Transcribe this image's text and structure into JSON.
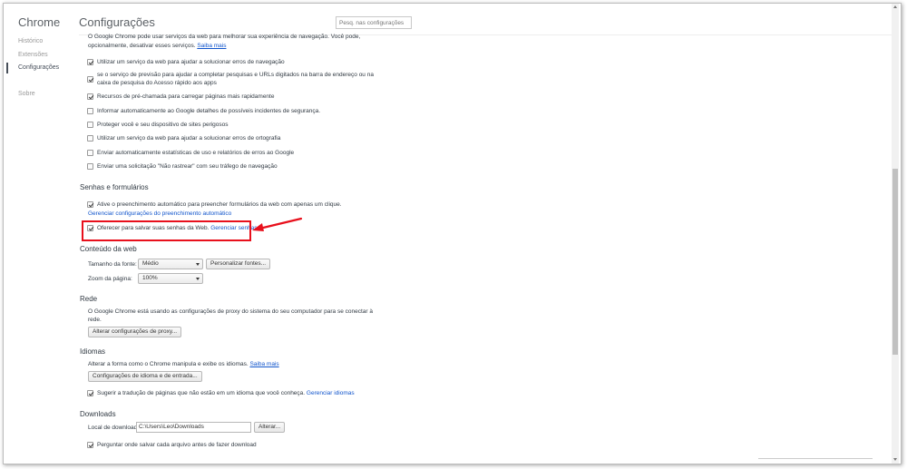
{
  "sidebar": {
    "brand": "Chrome",
    "items": [
      {
        "label": "Histórico"
      },
      {
        "label": "Extensões"
      },
      {
        "label": "Configurações",
        "active": true
      },
      {
        "label": "Sobre"
      }
    ]
  },
  "header": {
    "title": "Configurações",
    "search_placeholder": "Pesq. nas configurações"
  },
  "privacy": {
    "intro_line1": "O Google Chrome pode usar serviços da web para melhorar sua experiência de navegação. Você pode,",
    "intro_line2": "opcionalmente, desativar esses serviços. ",
    "learn_more": "Saiba mais",
    "options": [
      {
        "label": "Utilizar um serviço da web para ajudar a solucionar erros de navegação",
        "checked": true
      },
      {
        "label_line1": "se o serviço de previsão para ajudar a completar pesquisas e URLs digitados na barra de endereço ou na",
        "label_line2": "caixa de pesquisa do Acesso rápido aos apps",
        "checked": true
      },
      {
        "label": "Recursos de pré-chamada para carregar páginas mais rapidamente",
        "checked": true
      },
      {
        "label": "Informar automaticamente ao Google detalhes de possíveis incidentes de segurança.",
        "checked": false
      },
      {
        "label": "Proteger você e seu dispositivo de sites perigosos",
        "checked": false
      },
      {
        "label": "Utilizar um serviço da web para ajudar a solucionar erros de ortografia",
        "checked": false
      },
      {
        "label": "Enviar automaticamente estatísticas de uso e relatórios de erros ao Google",
        "checked": false
      },
      {
        "label": "Enviar uma solicitação \"Não rastrear\" com seu tráfego de navegação",
        "checked": false
      }
    ]
  },
  "passwords": {
    "title": "Senhas e formulários",
    "autofill_label": "Ative o preenchimento automático para preencher formulários da web com apenas um clique.",
    "autofill_link": "Gerenciar configurações do preenchimento automático",
    "save_passwords_label": "Oferecer para salvar suas senhas da Web. ",
    "save_passwords_link": "Gerenciar senhas"
  },
  "web_content": {
    "title": "Conteúdo da web",
    "font_size_label": "Tamanho da fonte:",
    "font_size_value": "Médio",
    "customize_fonts_button": "Personalizar fontes...",
    "zoom_label": "Zoom da página:",
    "zoom_value": "100%"
  },
  "network": {
    "title": "Rede",
    "desc_line1": "O Google Chrome está usando as configurações de proxy do sistema do seu computador para se conectar à",
    "desc_line2": "rede.",
    "proxy_button": "Alterar configurações de proxy..."
  },
  "languages": {
    "title": "Idiomas",
    "desc": "Alterar a forma como o Chrome manipula e exibe os idiomas. ",
    "learn_more": "Saiba mais",
    "settings_button": "Configurações de idioma e de entrada...",
    "translate_label": "Sugerir a tradução de páginas que não estão em um idioma que você conheça. ",
    "translate_link": "Gerenciar idiomas"
  },
  "downloads": {
    "title": "Downloads",
    "location_label": "Local de download:",
    "location_value": "C:\\Users\\Leo\\Downloads",
    "change_button": "Alterar...",
    "ask_label": "Perguntar onde salvar cada arquivo antes de fazer download"
  },
  "colors": {
    "highlight": "#e8101c",
    "link": "#1155cc"
  }
}
